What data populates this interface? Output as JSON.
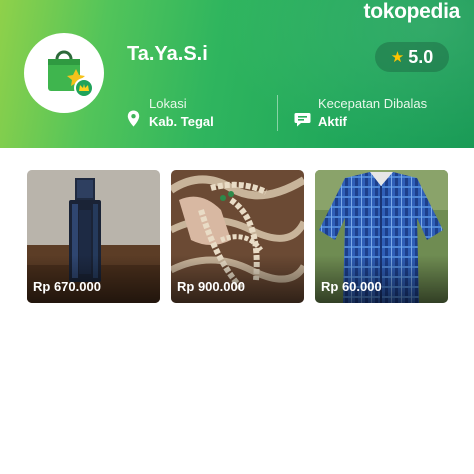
{
  "brand": {
    "name": "tokopedia"
  },
  "shop": {
    "name": "Ta.Ya.S.i",
    "rating": "5.0",
    "location_label": "Lokasi",
    "location_value": "Kab. Tegal",
    "response_label": "Kecepatan Dibalas",
    "response_value": "Aktif"
  },
  "products": [
    {
      "price": "Rp 670.000",
      "image": "perfume-bottle"
    },
    {
      "price": "Rp 900.000",
      "image": "prayer-beads"
    },
    {
      "price": "Rp 60.000",
      "image": "blue-plaid-shirt"
    }
  ],
  "colors": {
    "brand_green": "#03AC0E",
    "star": "#FFC400",
    "rating_bg": "#185A3C"
  }
}
